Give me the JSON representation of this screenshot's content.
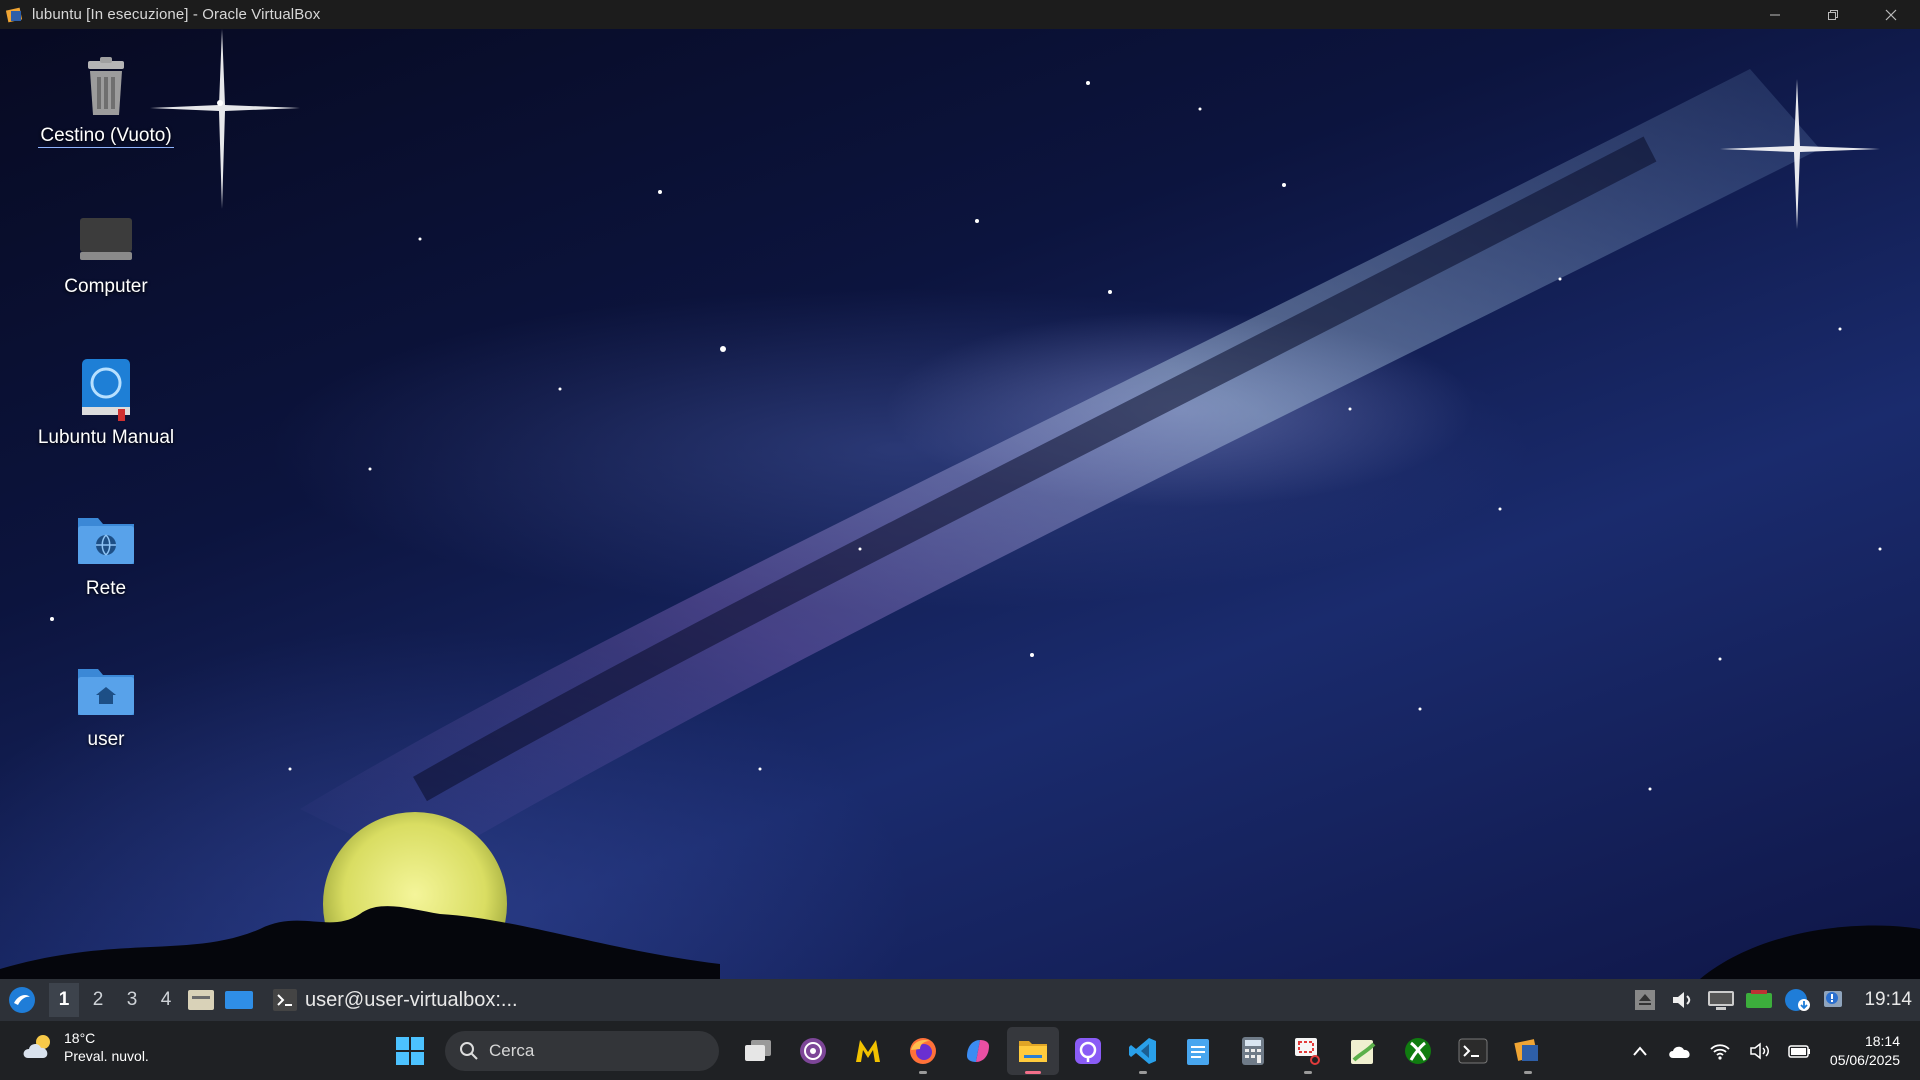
{
  "host_window": {
    "title": "lubuntu [In esecuzione] - Oracle VirtualBox"
  },
  "desktop": {
    "icons": [
      {
        "label": "Cestino (Vuoto)",
        "icon": "trash-icon"
      },
      {
        "label": "Computer",
        "icon": "computer-icon"
      },
      {
        "label": "Lubuntu Manual",
        "icon": "manual-icon"
      },
      {
        "label": "Rete",
        "icon": "network-folder-icon"
      },
      {
        "label": "user",
        "icon": "home-folder-icon"
      }
    ]
  },
  "lxqt_panel": {
    "workspaces": [
      "1",
      "2",
      "3",
      "4"
    ],
    "active_workspace": "1",
    "task_label": "user@user-virtualbox:...",
    "clock": "19:14",
    "colors": {
      "background": "#2d3138"
    }
  },
  "windows_taskbar": {
    "weather": {
      "temp": "18°C",
      "desc": "Preval. nuvol."
    },
    "search_placeholder": "Cerca",
    "apps": [
      "start-icon",
      "task-view-icon",
      "tor-browser-icon",
      "malwarebytes-icon",
      "firefox-icon",
      "copilot-icon",
      "file-explorer-icon",
      "proton-pass-icon",
      "vscode-icon",
      "notepad-icon",
      "calculator-icon",
      "snipping-tool-icon",
      "notepadpp-icon",
      "xbox-icon",
      "terminal-icon",
      "virtualbox-icon"
    ],
    "time": "18:14",
    "date": "05/06/2025"
  }
}
